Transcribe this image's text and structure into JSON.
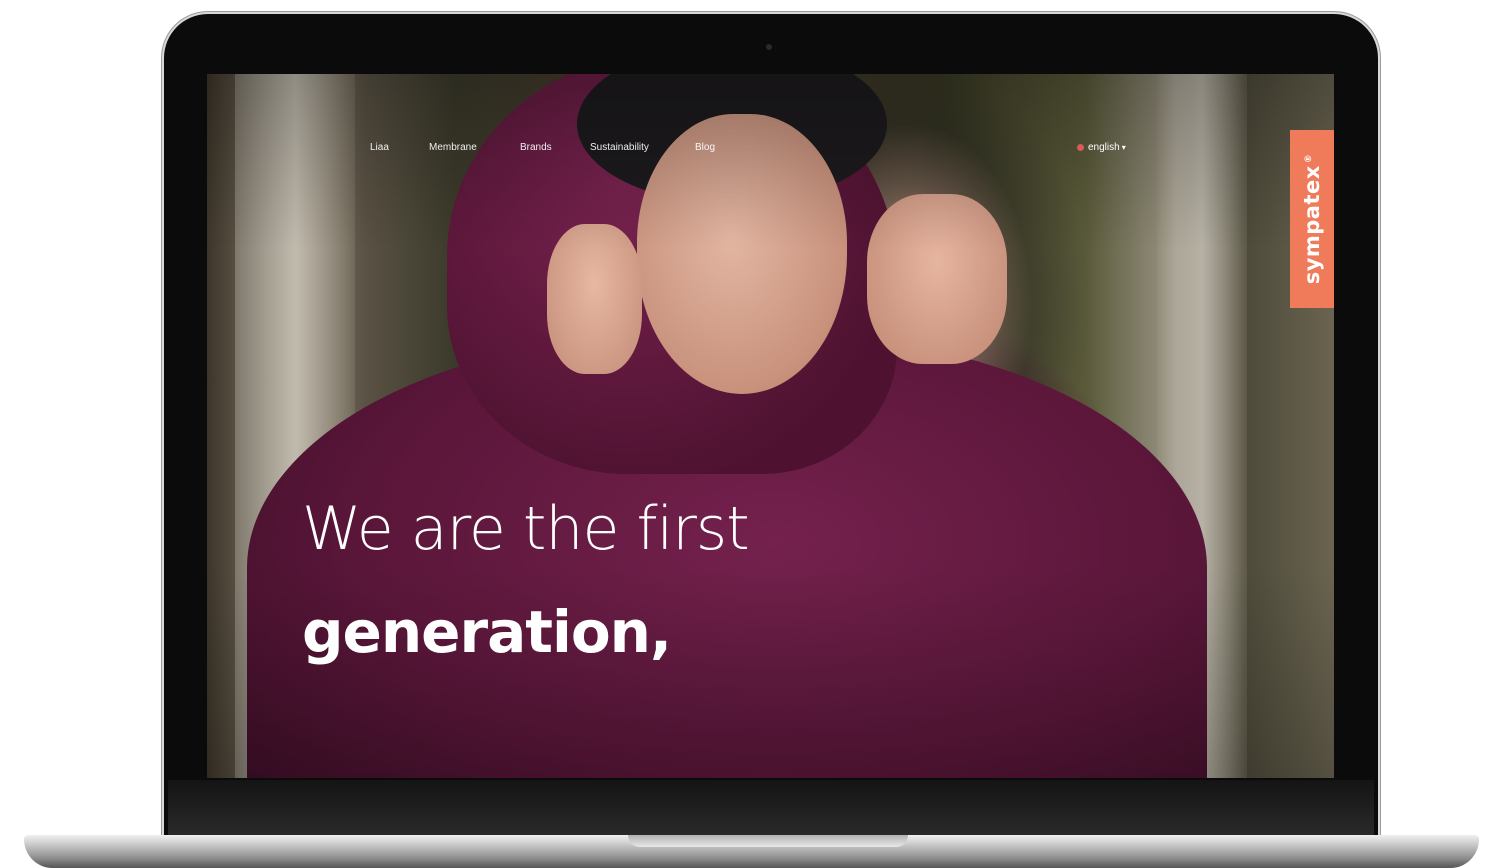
{
  "nav": {
    "items": [
      {
        "label": "",
        "active": true
      },
      {
        "label": "Liaa",
        "active": false
      },
      {
        "label": "Membrane",
        "active": false
      },
      {
        "label": "Brands",
        "active": false
      },
      {
        "label": "Sustainability",
        "active": false
      },
      {
        "label": "Blog",
        "active": false
      }
    ],
    "language": "english",
    "language_caret": "▾"
  },
  "brand": {
    "name": "sympatex",
    "registered_mark": "®"
  },
  "hero": {
    "line1": "We are the first",
    "line2": "generation,"
  },
  "colors": {
    "accent": "#ef7b5a",
    "active_nav": "#ff6a4a",
    "jacket": "#6a1b44"
  }
}
